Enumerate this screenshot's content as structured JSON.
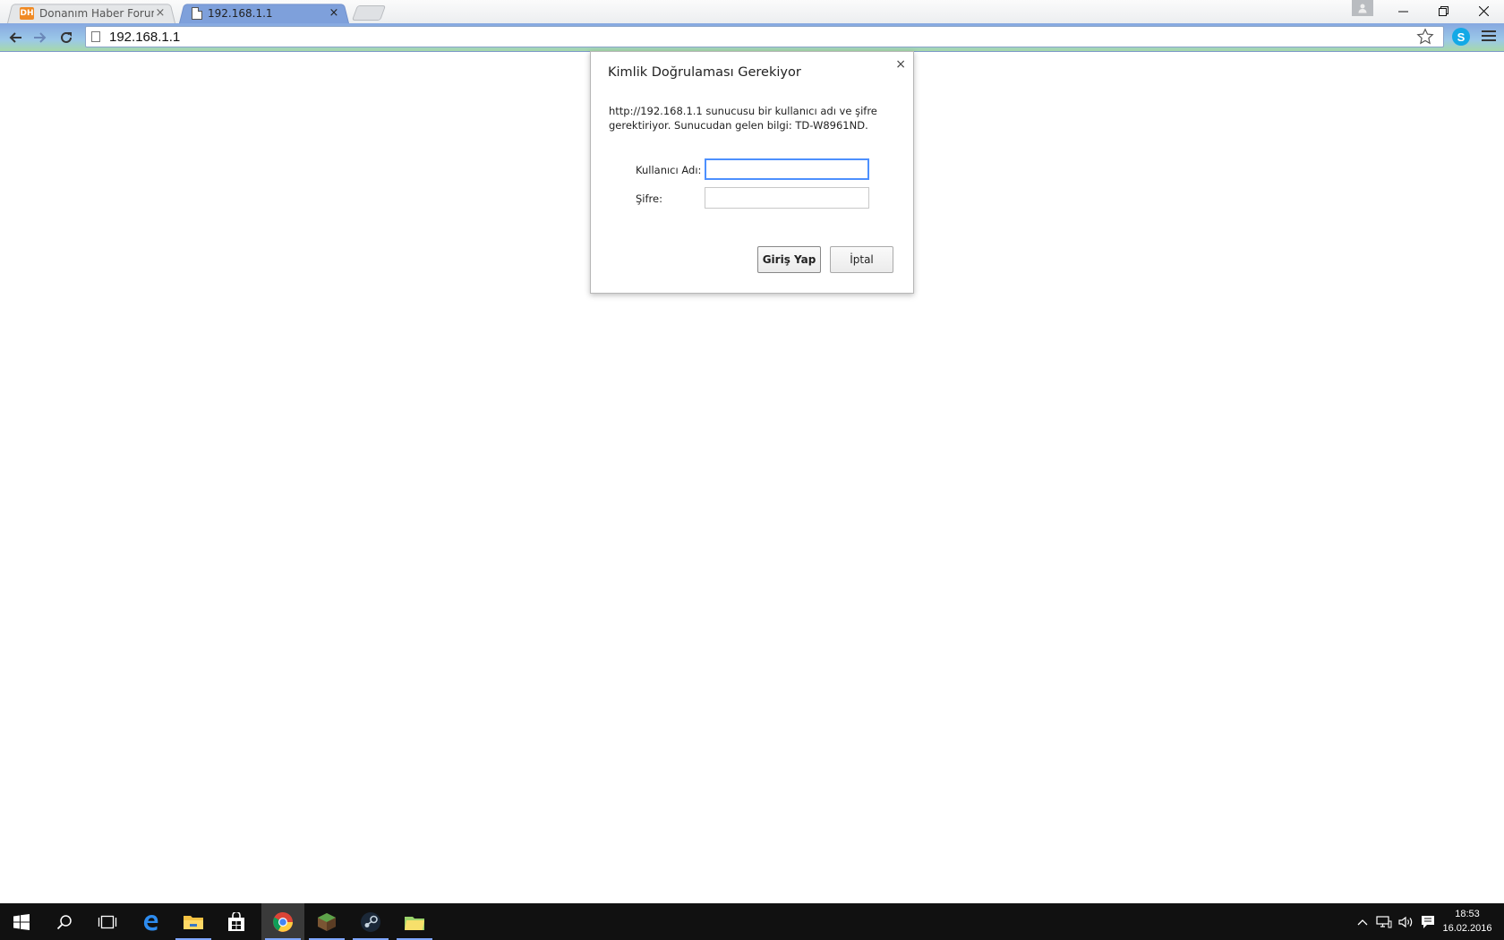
{
  "browser": {
    "tabs": [
      {
        "title": "Donanım Haber Forum",
        "favicon_text": "DH",
        "active": false
      },
      {
        "title": "192.168.1.1",
        "active": true
      }
    ],
    "tab_close_glyph": "×",
    "address": "192.168.1.1",
    "icons": {
      "back": "back-arrow-icon",
      "forward": "forward-arrow-icon",
      "reload": "reload-icon",
      "bookmark": "star-icon",
      "skype": "skype-icon",
      "menu": "hamburger-menu-icon"
    },
    "skype_letter": "S",
    "theme_colors": {
      "active_tab": "#7ea0db",
      "toolbar_top": "#86a8e0",
      "toolbar_bottom": "#a6d9a9"
    }
  },
  "window_controls": {
    "minimize": "—",
    "restore": "❐",
    "close": "✕"
  },
  "dialog": {
    "title": "Kimlik Doğrulaması Gerekiyor",
    "close_glyph": "×",
    "message": "http://192.168.1.1 sunucusu bir kullanıcı adı ve şifre gerektiriyor. Sunucudan gelen bilgi: TD-W8961ND.",
    "username_label": "Kullanıcı Adı:",
    "username_value": "",
    "password_label": "Şifre:",
    "password_value": "",
    "login_button": "Giriş Yap",
    "cancel_button": "İptal"
  },
  "taskbar": {
    "apps": [
      "start-icon",
      "search-icon",
      "task-view-icon",
      "edge-icon",
      "file-explorer-icon",
      "store-icon",
      "chrome-icon",
      "minecraft-icon",
      "steam-icon",
      "folder-app-icon"
    ],
    "tray_icons": [
      "show-hidden-icons-icon",
      "network-icon",
      "volume-icon",
      "action-center-icon"
    ],
    "time": "18:53",
    "date": "16.02.2016",
    "accent_color": "#7fa7ff"
  }
}
